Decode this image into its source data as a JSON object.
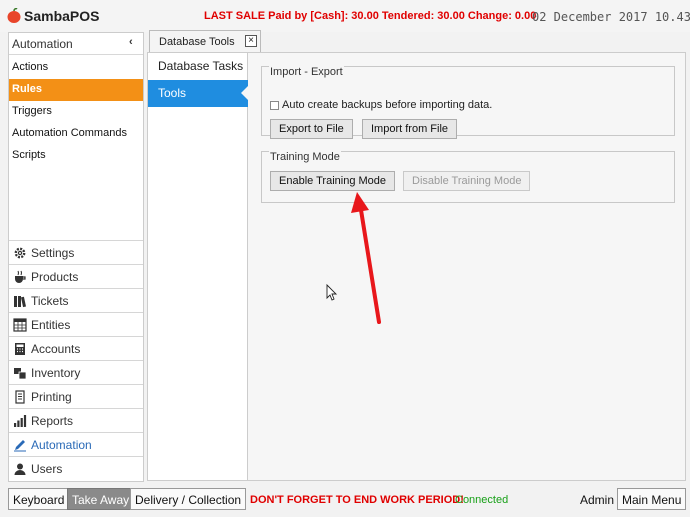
{
  "app": {
    "name": "SambaPOS",
    "last_sale": "LAST SALE Paid by [Cash]: 30.00  Tendered: 30.00  Change: 0.00",
    "clock": "02 December 2017 10.43"
  },
  "nav": {
    "header": "Automation",
    "collapse_glyph": "‹",
    "sub_items": [
      {
        "label": "Actions"
      },
      {
        "label": "Rules",
        "active": true
      },
      {
        "label": "Triggers"
      },
      {
        "label": "Automation Commands"
      },
      {
        "label": "Scripts"
      }
    ],
    "modules": [
      {
        "label": "Settings",
        "icon": "gear-icon"
      },
      {
        "label": "Products",
        "icon": "coffee-cup-icon"
      },
      {
        "label": "Tickets",
        "icon": "books-icon"
      },
      {
        "label": "Entities",
        "icon": "calendar-grid-icon"
      },
      {
        "label": "Accounts",
        "icon": "calculator-icon"
      },
      {
        "label": "Inventory",
        "icon": "inventory-icon"
      },
      {
        "label": "Printing",
        "icon": "printer-icon"
      },
      {
        "label": "Reports",
        "icon": "bar-chart-icon"
      },
      {
        "label": "Automation",
        "icon": "pencil-icon",
        "current": true
      },
      {
        "label": "Users",
        "icon": "user-icon"
      }
    ]
  },
  "tab": {
    "label": "Database Tools",
    "close_glyph": "×"
  },
  "tasks": [
    {
      "label": "Database Tasks"
    },
    {
      "label": "Tools",
      "active": true
    }
  ],
  "import_export": {
    "title": "Import - Export",
    "checkbox_label": "Auto create backups before importing data.",
    "checkbox_checked": false,
    "export_label": "Export to File",
    "import_label": "Import from File"
  },
  "training": {
    "title": "Training Mode",
    "enable_label": "Enable Training Mode",
    "disable_label": "Disable Training Mode"
  },
  "bottom": {
    "keyboard": "Keyboard",
    "take_away": "Take Away",
    "delivery": "Delivery / Collection",
    "warning": "DON'T FORGET TO END WORK PERIOD!",
    "status": "Connected",
    "user": "Admin",
    "main_menu": "Main Menu"
  },
  "colors": {
    "accent_orange": "#f39016",
    "accent_blue": "#1f8de0",
    "alert_red": "#e00000",
    "status_green": "#18a018",
    "annotation_arrow": "#e8171b"
  }
}
